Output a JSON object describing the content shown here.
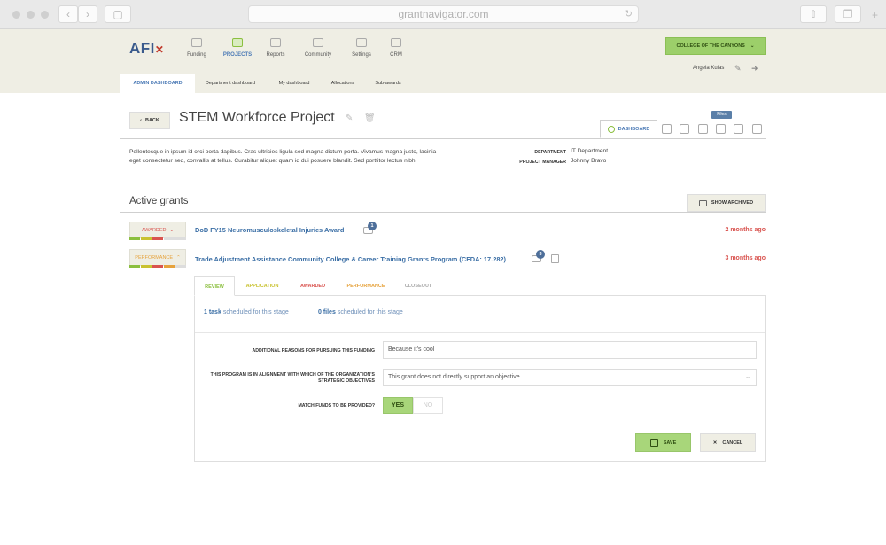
{
  "browser": {
    "url": "grantnavigator.com"
  },
  "app": {
    "logo": "AFI",
    "nav": [
      {
        "label": "Funding"
      },
      {
        "label": "PROJECTS"
      },
      {
        "label": "Reports"
      },
      {
        "label": "Community"
      },
      {
        "label": "Settings"
      },
      {
        "label": "CRM"
      }
    ],
    "college": "COLLEGE OF THE CANYONS",
    "user": "Angela Kulas"
  },
  "subnav": [
    "ADMIN DASHBOARD",
    "Department dashboard",
    "My dashboard",
    "Allocations",
    "Sub-awards"
  ],
  "project": {
    "back_label": "BACK",
    "title": "STEM Workforce Project",
    "dashboard_tab": "DASHBOARD",
    "tooltip": "Files",
    "description": "Pellentesque in ipsum id orci porta dapibus. Cras ultricies ligula sed magna dictum porta. Vivamus magna justo, lacinia eget consectetur sed, convallis at tellus. Curabitur aliquet quam id dui posuere blandit. Sed porttitor lectus nibh.",
    "department_label": "DEPARTMENT",
    "department": "IT Department",
    "manager_label": "PROJECT MANAGER",
    "manager": "Johnny Bravo"
  },
  "grants": {
    "heading": "Active grants",
    "show_archived": "SHOW ARCHIVED",
    "items": [
      {
        "status": "AWARDED",
        "status_color": "#d9534f",
        "title": "DoD FY15 Neuromusculoskeletal Injuries Award",
        "badge": "1",
        "time": "2 months ago"
      },
      {
        "status": "PERFORMANCE",
        "status_color": "#e6a23c",
        "title": "Trade Adjustment Assistance Community College & Career Training Grants Program (CFDA: 17.282)",
        "badge": "3",
        "time": "3 months ago"
      }
    ]
  },
  "stages": {
    "tabs": [
      {
        "label": "REVIEW",
        "color": "#8bbf3f"
      },
      {
        "label": "APPLICATION",
        "color": "#c9c231"
      },
      {
        "label": "AWARDED",
        "color": "#d9534f"
      },
      {
        "label": "PERFORMANCE",
        "color": "#e6a23c"
      },
      {
        "label": "CLOSEOUT",
        "color": "#aaaaaa"
      }
    ],
    "tasks_count": "1 task",
    "tasks_text": "scheduled for this stage",
    "files_count": "0 files",
    "files_text": "scheduled for this stage"
  },
  "form": {
    "reasons_label": "ADDITIONAL REASONS FOR PURSUING THIS FUNDING",
    "reasons_value": "Because it's cool",
    "alignment_label": "THIS PROGRAM IS IN ALIGNMENT WITH WHICH OF THE ORGANIZATION'S STRATEGIC OBJECTIVES",
    "alignment_value": "This grant does not directly support an objective",
    "match_label": "MATCH FUNDS TO BE PROVIDED?",
    "yes": "YES",
    "no": "NO",
    "save": "SAVE",
    "cancel": "CANCEL"
  }
}
